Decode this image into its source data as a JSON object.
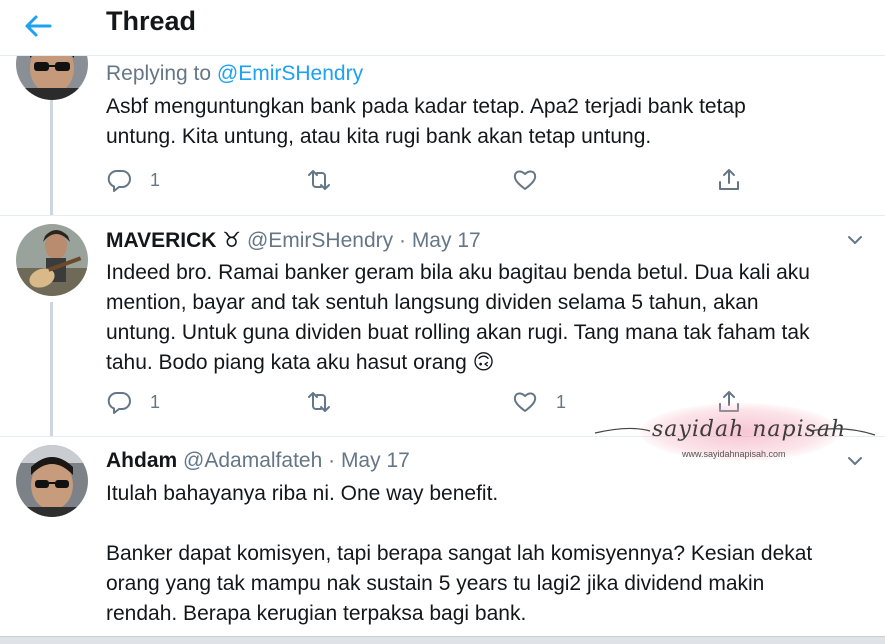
{
  "header": {
    "title": "Thread"
  },
  "tweets": [
    {
      "reply_prefix": "Replying to ",
      "reply_handle": "@EmirSHendry",
      "text": [
        "Asbf menguntungkan bank pada kadar tetap. Apa2 terjadi bank tetap",
        "untung. Kita untung, atau kita rugi bank akan tetap untung."
      ],
      "reply_count": "1"
    },
    {
      "name": "MAVERICK ♉",
      "handle": "@EmirSHendry",
      "sep": " · ",
      "date": "May 17",
      "text": [
        "Indeed bro. Ramai banker geram bila aku bagitau benda betul. Dua kali aku",
        "mention, bayar and tak sentuh langsung dividen selama 5 tahun, akan",
        "untung. Untuk guna dividen buat rolling akan rugi. Tang mana tak faham tak",
        "tahu. Bodo piang kata aku hasut orang 🙃"
      ],
      "reply_count": "1",
      "like_count": "1"
    },
    {
      "name": "Ahdam",
      "handle": "@Adamalfateh",
      "sep": " · ",
      "date": "May 17",
      "text": [
        "Itulah bahayanya riba ni. One way benefit.",
        "Banker dapat komisyen, tapi berapa sangat lah komisyennya? Kesian dekat",
        "orang yang tak mampu nak sustain 5 years tu lagi2 jika dividend makin",
        "rendah. Berapa kerugian terpaksa bagi bank."
      ]
    }
  ],
  "watermark": {
    "title": "sayidah napisah",
    "url": "www.sayidahnapisah.com"
  },
  "colors": {
    "accent": "#1da1f2",
    "secondary": "#657786",
    "text": "#14171a",
    "border": "#e6ecf0"
  },
  "icons": [
    "back-arrow-icon",
    "reply-icon",
    "retweet-icon",
    "like-icon",
    "share-icon",
    "chevron-down-icon"
  ]
}
